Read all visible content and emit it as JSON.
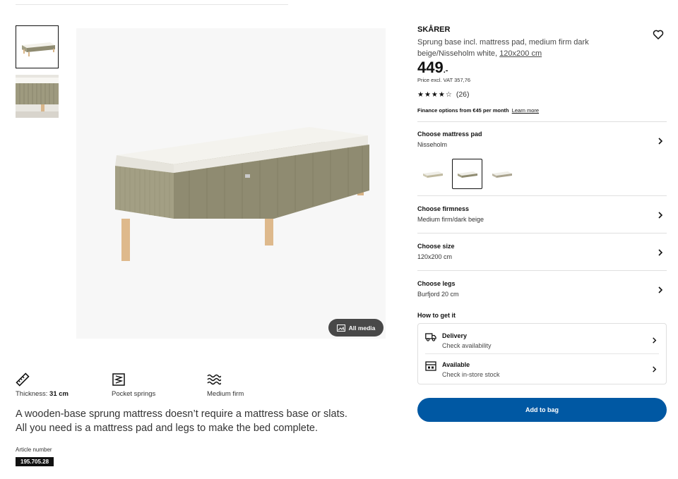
{
  "thumbnails": [
    {
      "name": "bed-overview"
    },
    {
      "name": "bed-detail"
    }
  ],
  "media": {
    "all_media_label": "All media"
  },
  "features": [
    {
      "label": "Thickness:",
      "value": "31 cm",
      "icon": "ruler-icon"
    },
    {
      "label": "Pocket springs",
      "value": "",
      "icon": "springs-icon"
    },
    {
      "label": "Medium firm",
      "value": "",
      "icon": "waves-icon"
    }
  ],
  "description": "A wooden-base sprung mattress doesn’t require a mattress base or slats. All you need is a mattress pad and legs to make the bed complete.",
  "article": {
    "label": "Article number",
    "number": "195.705.28"
  },
  "product": {
    "brand": "SKÅRER",
    "subtitle": "Sprung base incl. mattress pad, medium firm dark beige/Nisseholm white,",
    "size_link": "120x200 cm",
    "price_main": "449",
    "price_suffix": ".-",
    "price_excl": "Price excl. VAT 357,76",
    "rating_stars": "★★★★☆",
    "rating_count": "(26)",
    "finance_text": "Finance options from €45 per month",
    "finance_link": "Learn more"
  },
  "options": [
    {
      "heading": "Choose mattress pad",
      "value": "Nisseholm"
    },
    {
      "heading": "Choose firmness",
      "value": "Medium firm/dark beige"
    },
    {
      "heading": "Choose size",
      "value": "120x200 cm"
    },
    {
      "heading": "Choose legs",
      "value": "Burfjord 20 cm"
    }
  ],
  "how_to_get": {
    "heading": "How to get it",
    "delivery": {
      "title": "Delivery",
      "sub": "Check availability"
    },
    "store": {
      "title": "Available",
      "sub": "Check in-store stock"
    }
  },
  "cta": {
    "add_to_bag": "Add to bag"
  },
  "colors": {
    "accent": "#0058a3",
    "fabric": "#a39f84",
    "wood": "#d9b68a"
  }
}
